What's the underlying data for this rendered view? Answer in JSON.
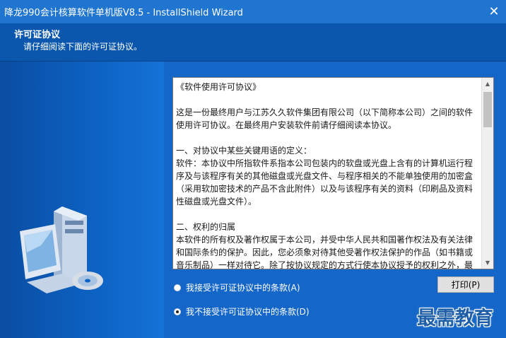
{
  "window": {
    "title": "降龙990会计核算软件单机版V8.5 - InstallShield Wizard",
    "close_glyph": "✕"
  },
  "header": {
    "title": "许可证协议",
    "subtitle": "请仔细阅读下面的许可证协议。"
  },
  "license": {
    "paragraphs": [
      "《软件使用许可协议》",
      "这是一份最终用户与江苏久久软件集团有限公司（以下简称本公司）之间的软件使用许可协议。在最终用户安装软件前请仔细阅读本协议。",
      "一、对协议中某些关键用语的定义：",
      "软件：本协议中所指软件系指本公司包装内的软盘或光盘上含有的计算机运行程序及与该程序有关的其他磁盘或光盘文件、与程序相关的不能单独使用的加密盒（采用软加密技术的产品不含此附件）以及与该程序有关的资料（印刷品及资料性磁盘或光盘文件）。",
      "二、权利的归属",
      "本软件的所有权及著作权属于本公司，并受中华人民共和国著作权法及有关法律和国际条约的保护。因此，您必须象对待其他受著作权法保护的作品（如书籍或音乐制品）一样对待它。除了按协议规定的方式行使本协议授予的权利之外，最终用户不得以其他任何方式行使本软件的其他权利。"
    ]
  },
  "options": {
    "accept_label": "我接受许可证协议中的条款(A)",
    "decline_label": "我不接受许可证协议中的条款(D)",
    "selected": "decline"
  },
  "buttons": {
    "print_label": "打印(P)"
  },
  "watermark": {
    "text": "最需教育"
  },
  "colors": {
    "titlebar": "#1f75cf",
    "header": "#0b57ad",
    "background": "#1466c8",
    "watermark": "#1e5fa8"
  },
  "icons": {
    "scroll_up": "▲",
    "scroll_down": "▼"
  }
}
